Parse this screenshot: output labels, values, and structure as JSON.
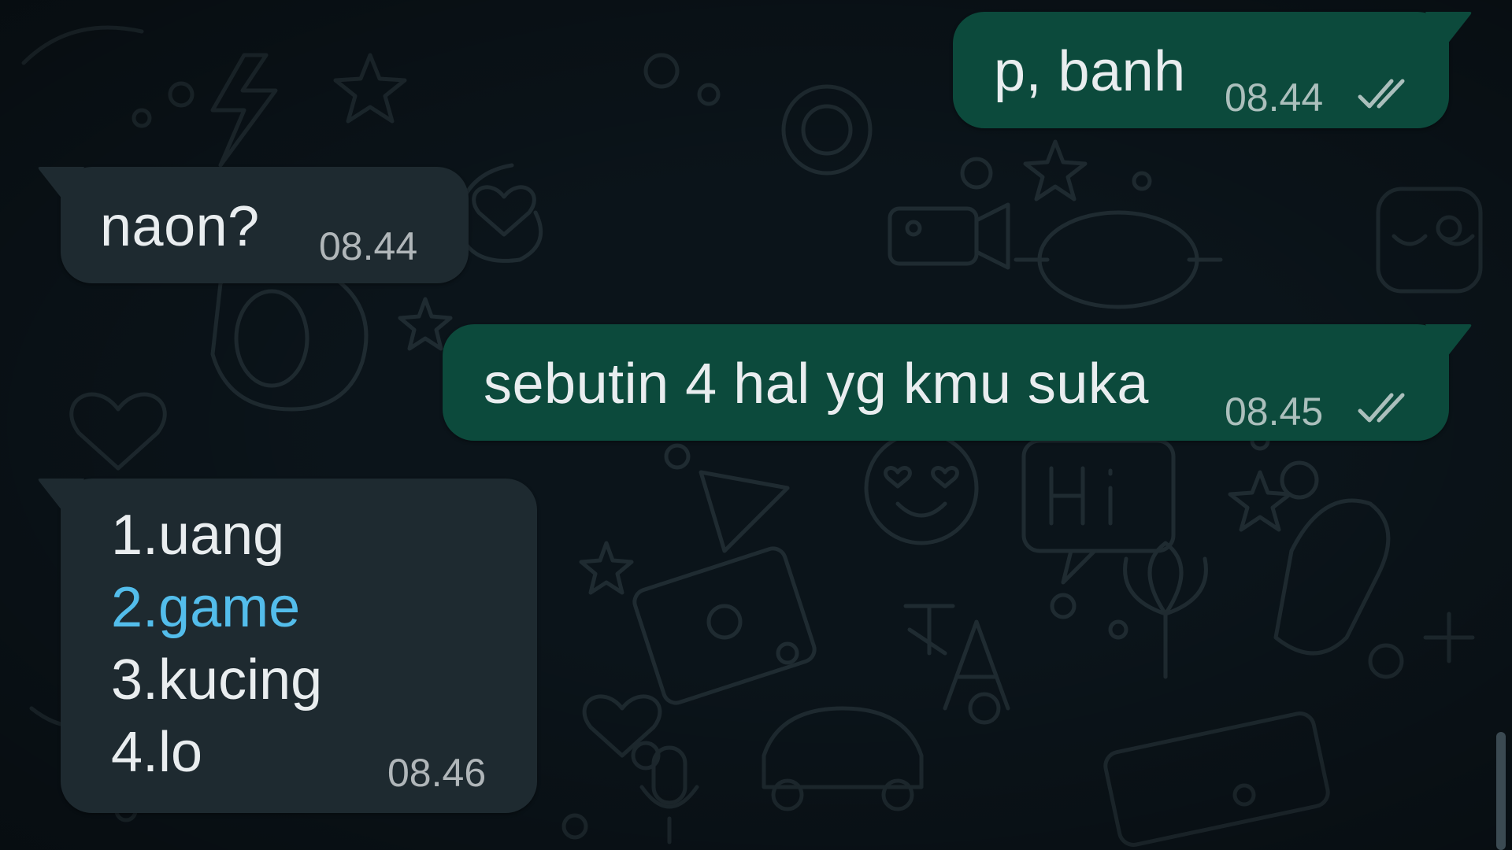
{
  "chat": {
    "messages": [
      {
        "direction": "outgoing",
        "text": "p, banh",
        "time": "08.44",
        "status_icon": "double-check-icon"
      },
      {
        "direction": "incoming",
        "text": "naon?",
        "time": "08.44"
      },
      {
        "direction": "outgoing",
        "text": "sebutin 4 hal yg kmu suka",
        "time": "08.45",
        "status_icon": "double-check-icon"
      },
      {
        "direction": "incoming",
        "lines": [
          "1.uang",
          "2.game",
          "3.kucing",
          "4.lo"
        ],
        "time": "08.46"
      }
    ]
  },
  "colors": {
    "outgoing_bubble": "#0c4a3c",
    "incoming_bubble": "#1e2a30",
    "background": "#0b141a",
    "link": "#53bdeb"
  }
}
